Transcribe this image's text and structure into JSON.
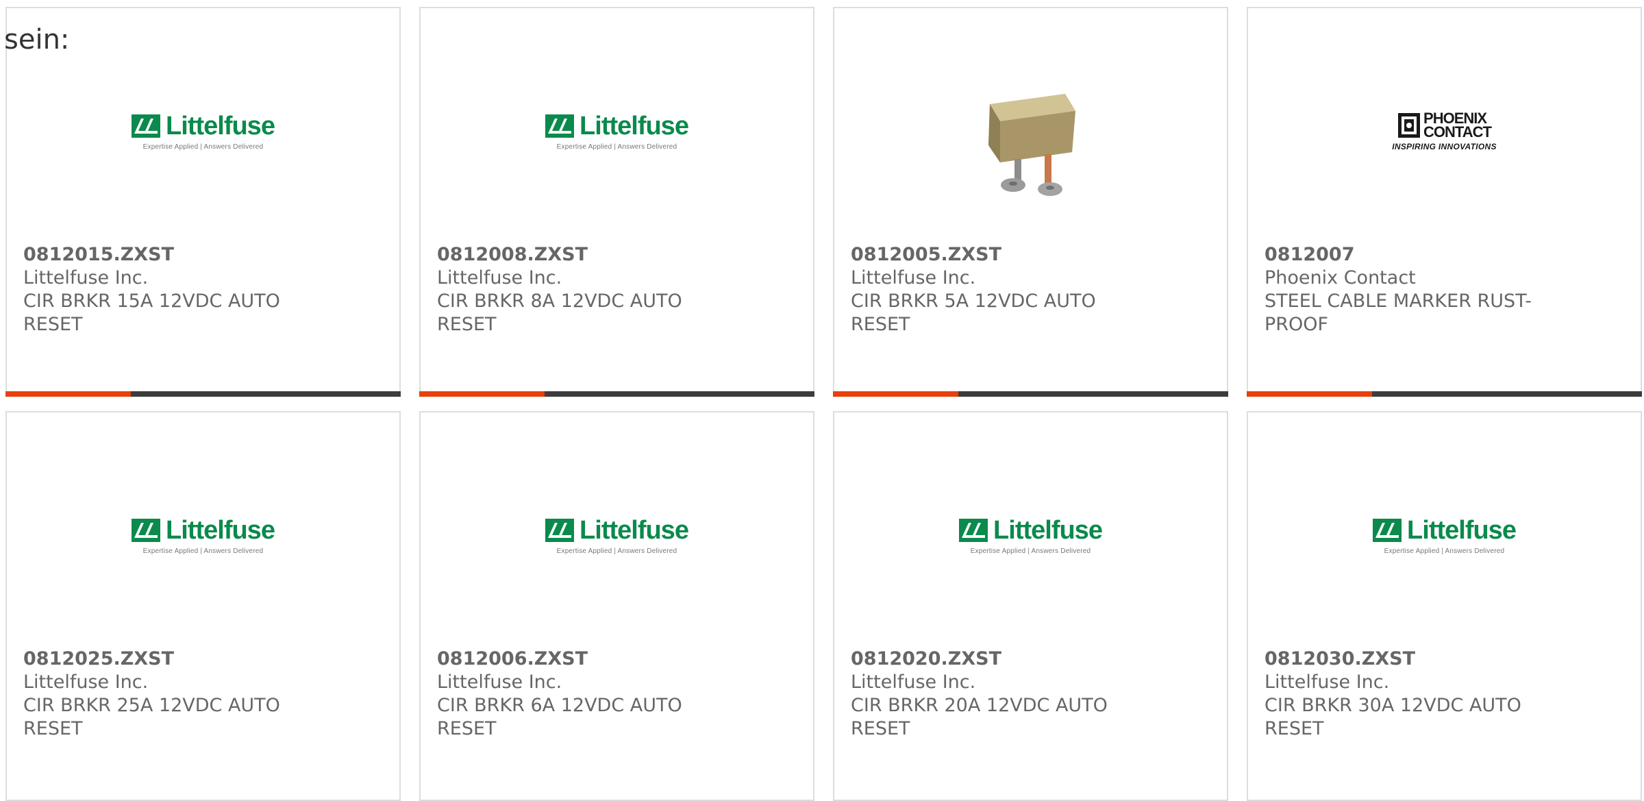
{
  "lead_text": "sein:",
  "colors": {
    "accent_bar": "#e8400c",
    "bar_dark": "#3d3d3d",
    "littelfuse_green": "#0a8a4c",
    "text_gray": "#666666"
  },
  "logos": {
    "littelfuse": {
      "name": "Littelfuse",
      "tagline": "Expertise Applied | Answers Delivered"
    },
    "phoenix": {
      "name_line1": "PHOENIX",
      "name_line2": "CONTACT",
      "tagline": "INSPIRING INNOVATIONS"
    }
  },
  "products": [
    {
      "part_number": "0812015.ZXST",
      "manufacturer": "Littelfuse Inc.",
      "description": "CIR BRKR 15A 12VDC AUTO RESET",
      "image": "littelfuse-logo"
    },
    {
      "part_number": "0812008.ZXST",
      "manufacturer": "Littelfuse Inc.",
      "description": "CIR BRKR 8A 12VDC AUTO RESET",
      "image": "littelfuse-logo"
    },
    {
      "part_number": "0812005.ZXST",
      "manufacturer": "Littelfuse Inc.",
      "description": "CIR BRKR 5A 12VDC AUTO RESET",
      "image": "circuit-breaker-photo"
    },
    {
      "part_number": "0812007",
      "manufacturer": "Phoenix Contact",
      "description": "STEEL CABLE MARKER RUST-PROOF",
      "image": "phoenix-contact-logo"
    },
    {
      "part_number": "0812025.ZXST",
      "manufacturer": "Littelfuse Inc.",
      "description": "CIR BRKR 25A 12VDC AUTO RESET",
      "image": "littelfuse-logo"
    },
    {
      "part_number": "0812006.ZXST",
      "manufacturer": "Littelfuse Inc.",
      "description": "CIR BRKR 6A 12VDC AUTO RESET",
      "image": "littelfuse-logo"
    },
    {
      "part_number": "0812020.ZXST",
      "manufacturer": "Littelfuse Inc.",
      "description": "CIR BRKR 20A 12VDC AUTO RESET",
      "image": "littelfuse-logo"
    },
    {
      "part_number": "0812030.ZXST",
      "manufacturer": "Littelfuse Inc.",
      "description": "CIR BRKR 30A 12VDC AUTO RESET",
      "image": "littelfuse-logo"
    }
  ]
}
